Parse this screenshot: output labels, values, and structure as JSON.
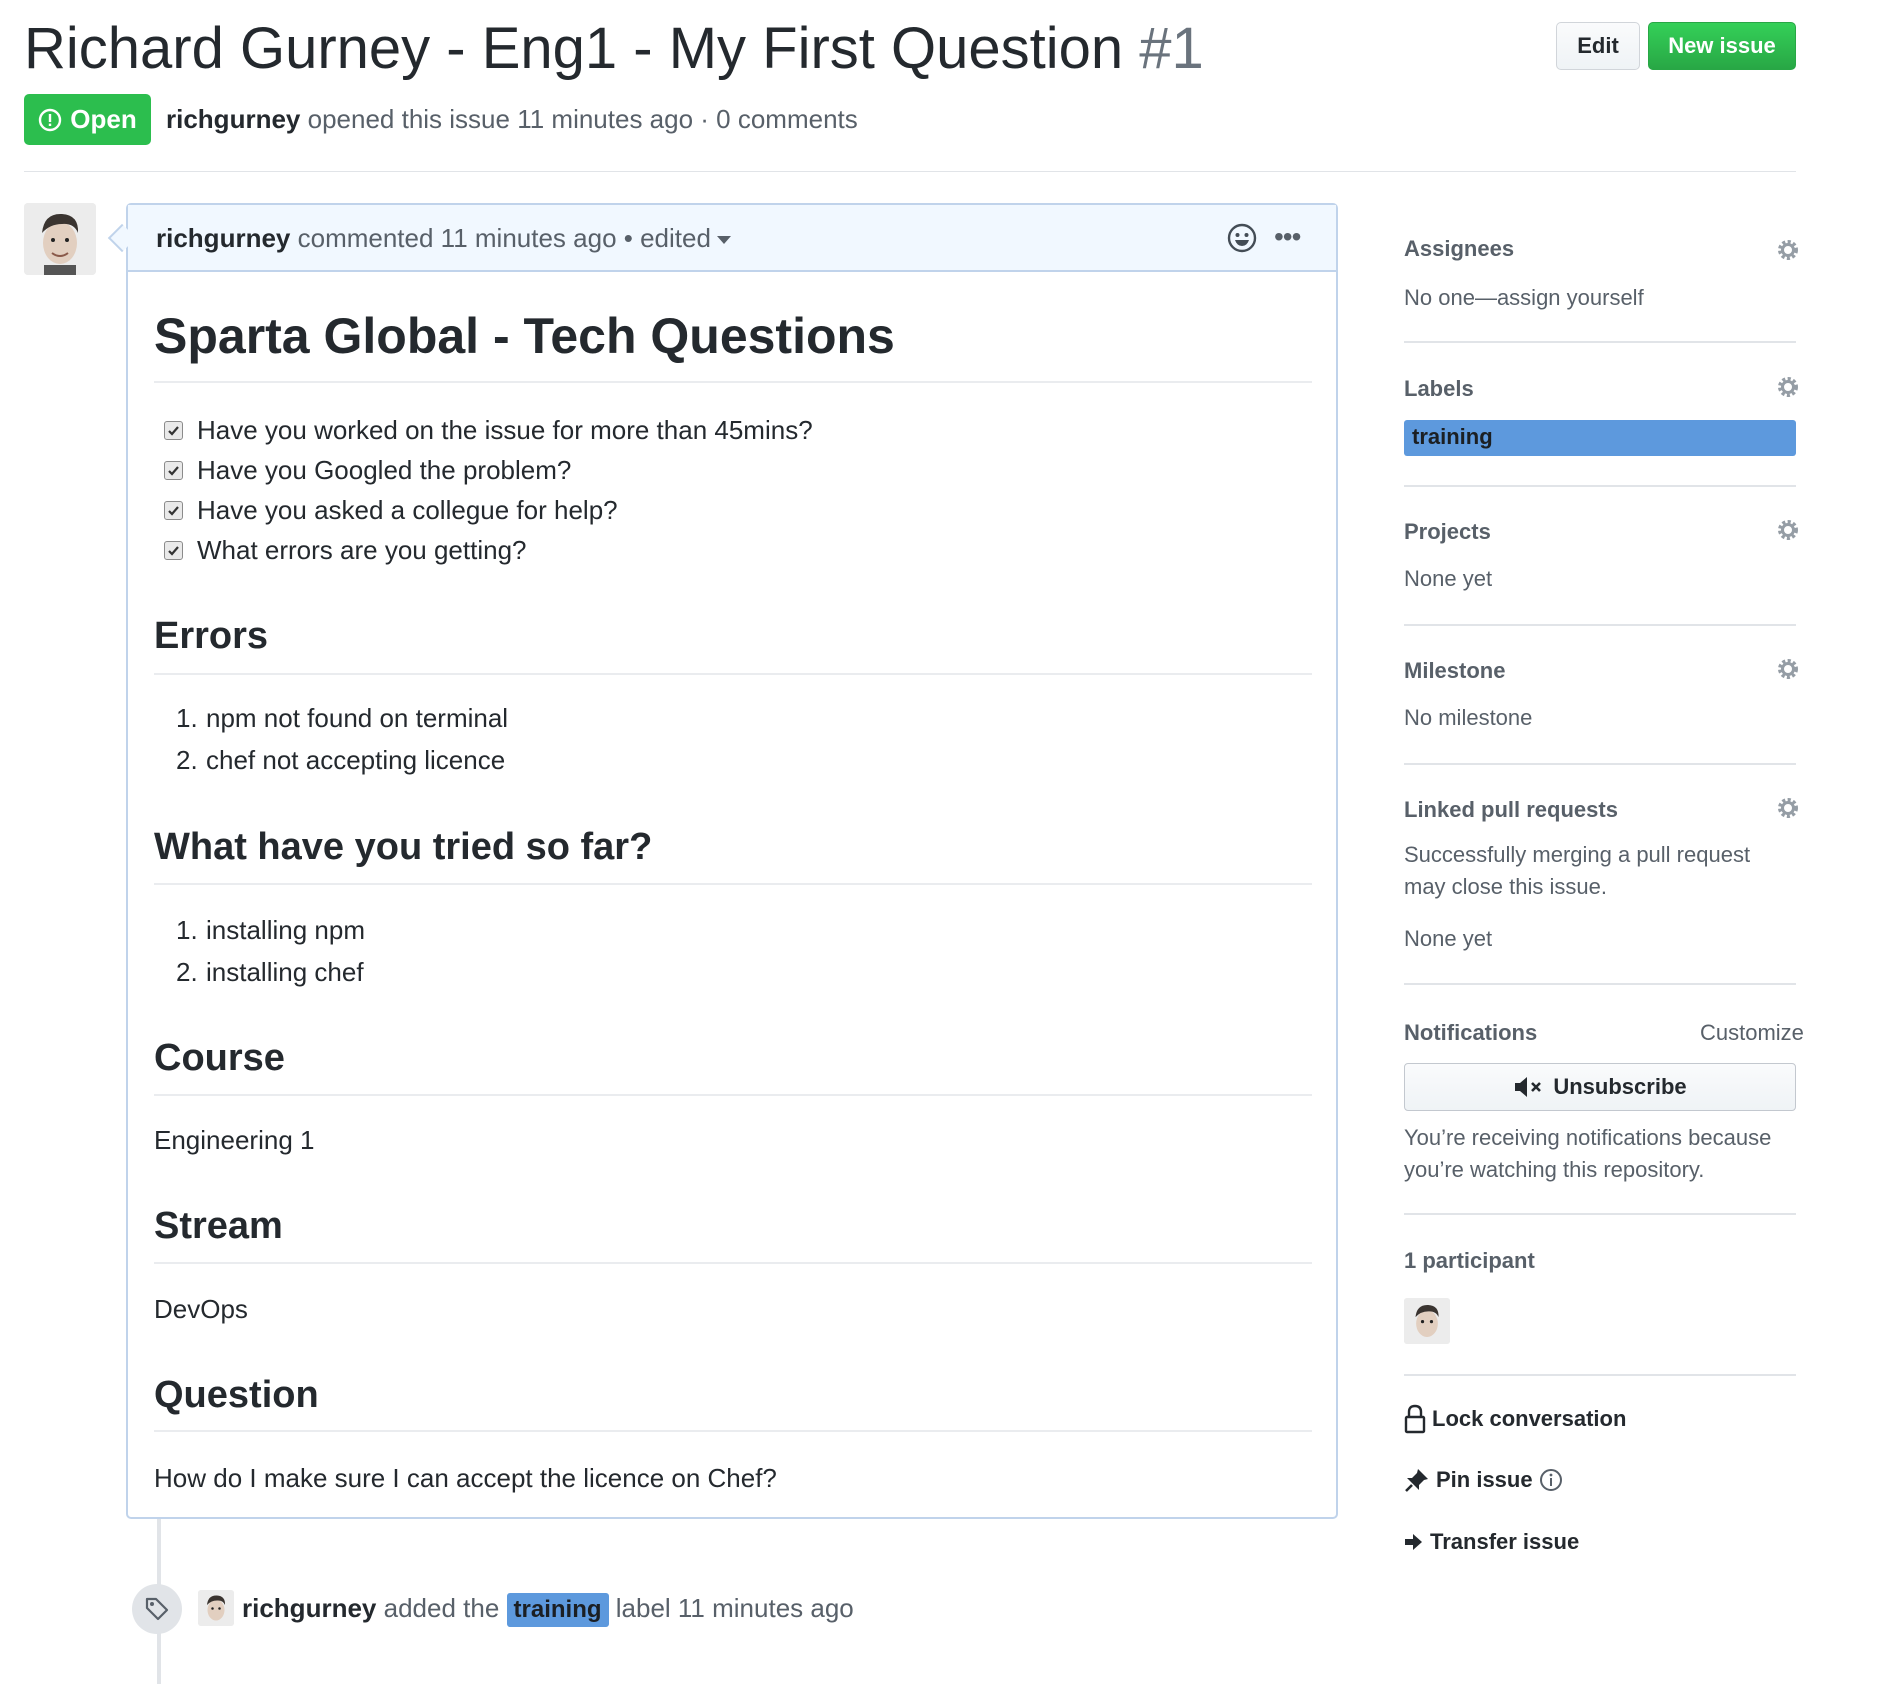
{
  "issue": {
    "title": "Richard Gurney - Eng1 - My First Question",
    "number": "#1",
    "state": "Open",
    "author": "richgurney",
    "opened_text": "opened this issue 11 minutes ago · 0 comments"
  },
  "header_buttons": {
    "edit": "Edit",
    "new_issue": "New issue"
  },
  "comment": {
    "author": "richgurney",
    "meta": "commented 11 minutes ago • edited",
    "heading": "Sparta Global - Tech Questions",
    "tasks": [
      "Have you worked on the issue for more than 45mins?",
      "Have you Googled the problem?",
      "Have you asked a collegue for help?",
      "What errors are you getting?"
    ],
    "errors_heading": "Errors",
    "errors": [
      "npm not found on terminal",
      "chef not accepting licence"
    ],
    "tried_heading": "What have you tried so far?",
    "tried": [
      "installing npm",
      "installing chef"
    ],
    "course_heading": "Course",
    "course": "Engineering 1",
    "stream_heading": "Stream",
    "stream": "DevOps",
    "question_heading": "Question",
    "question": "How do I make sure I can accept the licence on Chef?"
  },
  "event": {
    "author": "richgurney",
    "prefix": "added the",
    "label": "training",
    "suffix": "label 11 minutes ago"
  },
  "sidebar": {
    "assignees": {
      "title": "Assignees",
      "value": "No one—assign yourself"
    },
    "labels": {
      "title": "Labels",
      "label": "training",
      "label_color": "#5d99dd"
    },
    "projects": {
      "title": "Projects",
      "value": "None yet"
    },
    "milestone": {
      "title": "Milestone",
      "value": "No milestone"
    },
    "linked": {
      "title": "Linked pull requests",
      "desc": "Successfully merging a pull request may close this issue.",
      "value": "None yet"
    },
    "notifications": {
      "title": "Notifications",
      "customize": "Customize",
      "button": "Unsubscribe",
      "reason": "You’re receiving notifications because you’re watching this repository."
    },
    "participants": {
      "title": "1 participant"
    },
    "actions": {
      "lock": "Lock conversation",
      "pin": "Pin issue",
      "transfer": "Transfer issue"
    }
  },
  "colors": {
    "open_green": "#2cbe4e",
    "label_blue": "#5d99dd",
    "border_blue": "#c0d3eb"
  }
}
